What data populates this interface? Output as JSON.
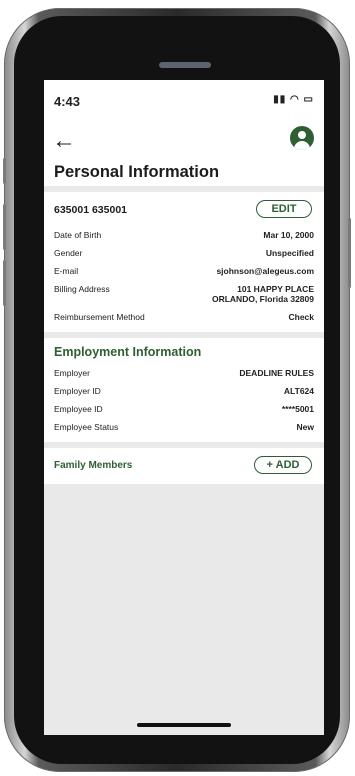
{
  "status": {
    "time": "4:43",
    "icons": "▮▮ ◠ ▭"
  },
  "header": {
    "title": "Personal Information"
  },
  "personal": {
    "account": "635001 635001",
    "edit_label": "EDIT",
    "fields": [
      {
        "label": "Date of Birth",
        "value": "Mar 10, 2000"
      },
      {
        "label": "Gender",
        "value": "Unspecified"
      },
      {
        "label": "E-mail",
        "value": "sjohnson@alegeus.com"
      },
      {
        "label": "Billing Address",
        "value_line1": "101 HAPPY PLACE",
        "value_line2": "ORLANDO, Florida 32809"
      },
      {
        "label": "Reimbursement Method",
        "value": "Check"
      }
    ]
  },
  "employment": {
    "title": "Employment Information",
    "fields": [
      {
        "label": "Employer",
        "value": "DEADLINE RULES"
      },
      {
        "label": "Employer ID",
        "value": "ALT624"
      },
      {
        "label": "Employee ID",
        "value": "****5001"
      },
      {
        "label": "Employee Status",
        "value": "New"
      }
    ]
  },
  "family": {
    "title": "Family Members",
    "add_label": "+ ADD"
  },
  "colors": {
    "accent": "#2f5e34",
    "screen_bg": "#e9e9e9"
  }
}
